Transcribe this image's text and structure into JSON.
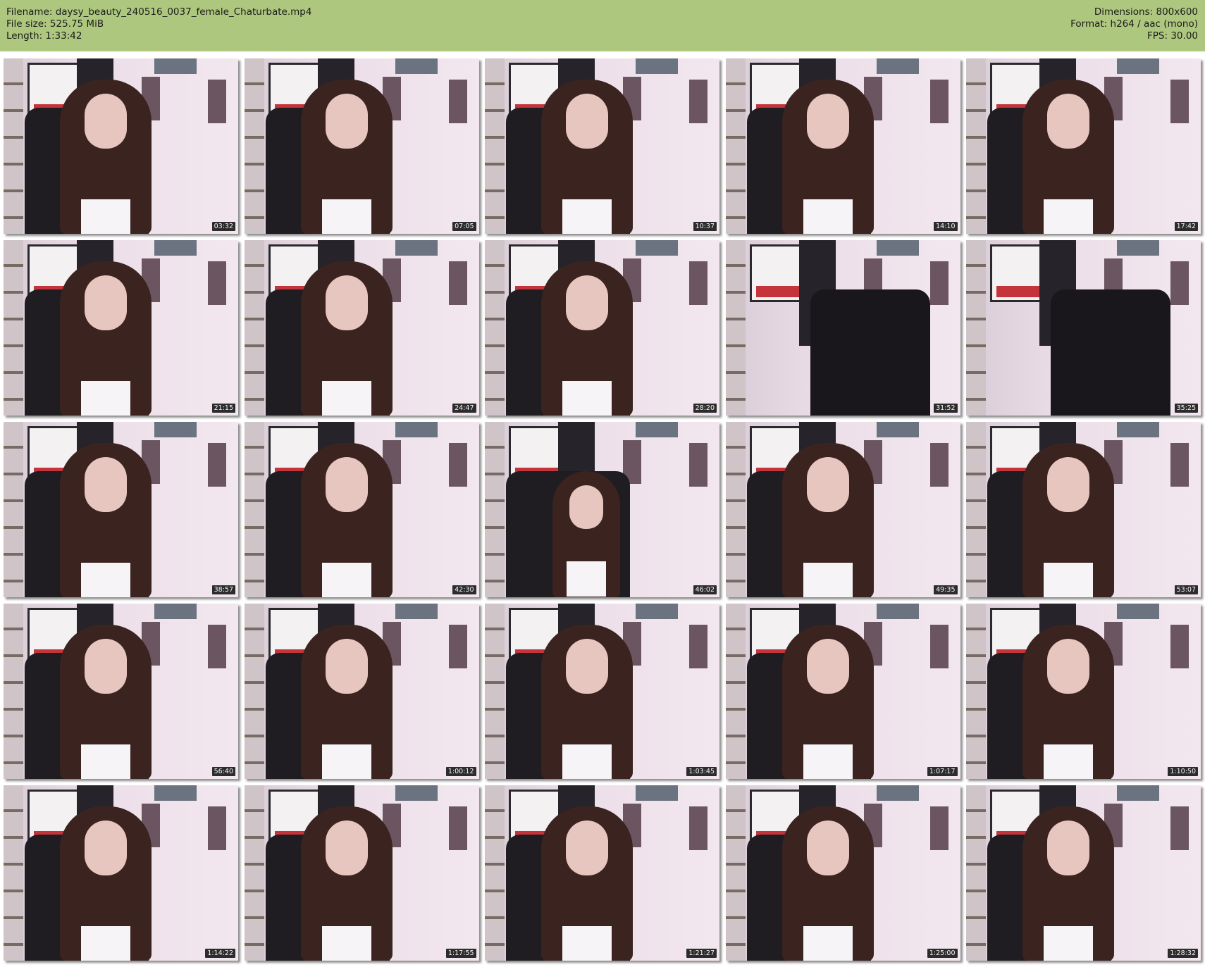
{
  "header": {
    "filename": "Filename: daysy_beauty_240516_0037_female_Chaturbate.mp4",
    "filesize": "File size: 525.75 MiB",
    "length": "Length: 1:33:42",
    "dimensions": "Dimensions: 800x600",
    "format": "Format: h264 / aac (mono)",
    "fps": "FPS: 30.00"
  },
  "thumbnails": [
    {
      "time": "03:32"
    },
    {
      "time": "07:05"
    },
    {
      "time": "10:37"
    },
    {
      "time": "14:10"
    },
    {
      "time": "17:42"
    },
    {
      "time": "21:15"
    },
    {
      "time": "24:47"
    },
    {
      "time": "28:20"
    },
    {
      "time": "31:52",
      "empty": true
    },
    {
      "time": "35:25",
      "empty": true
    },
    {
      "time": "38:57"
    },
    {
      "time": "42:30"
    },
    {
      "time": "46:02",
      "small": true
    },
    {
      "time": "49:35"
    },
    {
      "time": "53:07"
    },
    {
      "time": "56:40"
    },
    {
      "time": "1:00:12"
    },
    {
      "time": "1:03:45"
    },
    {
      "time": "1:07:17"
    },
    {
      "time": "1:10:50"
    },
    {
      "time": "1:14:22"
    },
    {
      "time": "1:17:55"
    },
    {
      "time": "1:21:27"
    },
    {
      "time": "1:25:00"
    },
    {
      "time": "1:28:32"
    }
  ]
}
